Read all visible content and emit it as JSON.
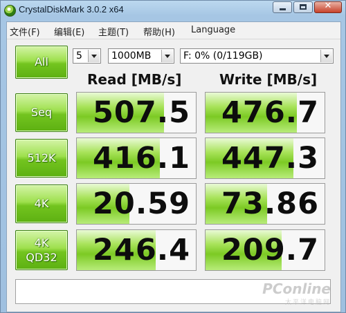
{
  "window": {
    "title": "CrystalDiskMark 3.0.2 x64"
  },
  "menu": {
    "items": [
      {
        "label": "文件(F)"
      },
      {
        "label": "编辑(E)"
      },
      {
        "label": "主题(T)"
      },
      {
        "label": "帮助(H)"
      },
      {
        "label": "Language"
      }
    ]
  },
  "controls": {
    "all_label": "All",
    "count": "5",
    "size": "1000MB",
    "drive": "F: 0% (0/119GB)"
  },
  "headers": {
    "read": "Read [MB/s]",
    "write": "Write [MB/s]"
  },
  "rows": [
    {
      "label_line1": "Seq",
      "label_line2": "",
      "read": "507.5",
      "write": "476.7",
      "read_fill": 0.73,
      "write_fill": 0.77
    },
    {
      "label_line1": "512K",
      "label_line2": "",
      "read": "416.1",
      "write": "447.3",
      "read_fill": 0.7,
      "write_fill": 0.74
    },
    {
      "label_line1": "4K",
      "label_line2": "",
      "read": "20.59",
      "write": "73.86",
      "read_fill": 0.44,
      "write_fill": 0.52
    },
    {
      "label_line1": "4K",
      "label_line2": "QD32",
      "read": "246.4",
      "write": "209.7",
      "read_fill": 0.66,
      "write_fill": 0.64
    }
  ],
  "comment": "",
  "watermark": {
    "main": "PConline",
    "sub": "太平洋电脑网"
  },
  "colors": {
    "accent_green": "#7cca24",
    "title_bar": "#a6c6e4"
  }
}
